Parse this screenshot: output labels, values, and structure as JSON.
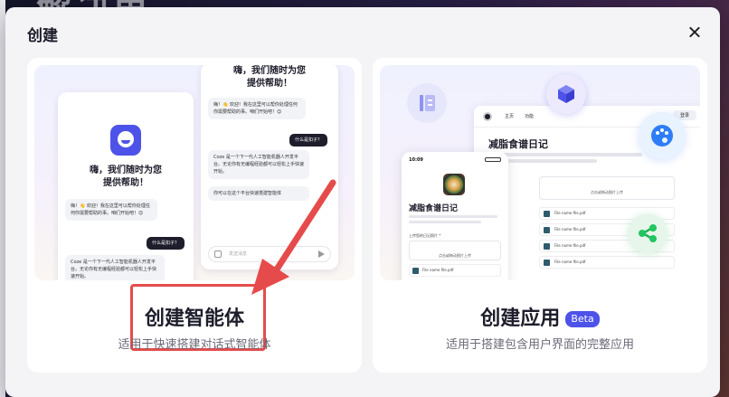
{
  "backdrop": {
    "heading_fragment": "解决里"
  },
  "dialog": {
    "title": "创建",
    "close_label": "×"
  },
  "cards": {
    "agent": {
      "title": "创建智能体",
      "description": "适用于快速搭建对话式智能体",
      "preview": {
        "greeting_a": "嗨，我们随时为您\n提供帮助！",
        "greeting_b": "嗨，我们随时为您\n提供帮助！",
        "bot_msg_1": "嗨！👋 欢迎！我在这里可以帮你处理任何你需要帮助的事。咱们开始吧！😊",
        "user_msg": "什么是扣子？",
        "bot_msg_2": "Coze 是一个下一代人工智能机器人开发平台。无论你有无编程经验都可以轻松上手快速开始。",
        "bot_msg_3": "你可以在这个平台快速搭建智能体",
        "input_placeholder": "发送消息"
      }
    },
    "app": {
      "title": "创建应用",
      "badge": "Beta",
      "description": "适用于搭建包含用户界面的完整应用",
      "preview": {
        "web_tab_1": "主页",
        "web_tab_2": "功能",
        "web_login": "登录",
        "web_title": "减脂食谱日记",
        "upload_label": "点击或拖动图片上传",
        "file_name": "File name file.pdf",
        "mobile_time": "10:09",
        "mobile_title": "减脂食谱日记",
        "mobile_upload_label": "上传您的日记照片 *",
        "mobile_upload_hint": "点击或拖动图片上传",
        "mobile_file": "File name file.pdf"
      }
    }
  },
  "colors": {
    "accent": "#4d53e8",
    "annotation": "#e64b4b"
  }
}
